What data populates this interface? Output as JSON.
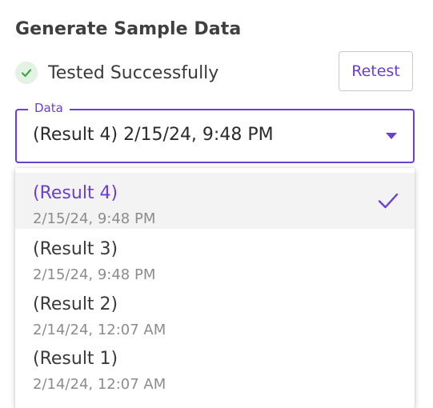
{
  "heading": "Generate Sample Data",
  "status": {
    "icon": "check-circle-icon",
    "text": "Tested Successfully",
    "icon_color": "#3fa54a"
  },
  "retest_label": "Retest",
  "data_select": {
    "label": "Data",
    "value": "(Result 4) 2/15/24, 9:48 PM",
    "accent_color": "#6a3fd6"
  },
  "options": [
    {
      "title": "(Result 4)",
      "subtitle": "2/15/24, 9:48 PM",
      "selected": true
    },
    {
      "title": "(Result 3)",
      "subtitle": "2/15/24, 9:48 PM",
      "selected": false
    },
    {
      "title": "(Result 2)",
      "subtitle": "2/14/24, 12:07 AM",
      "selected": false
    },
    {
      "title": "(Result 1)",
      "subtitle": "2/14/24, 12:07 AM",
      "selected": false
    }
  ]
}
